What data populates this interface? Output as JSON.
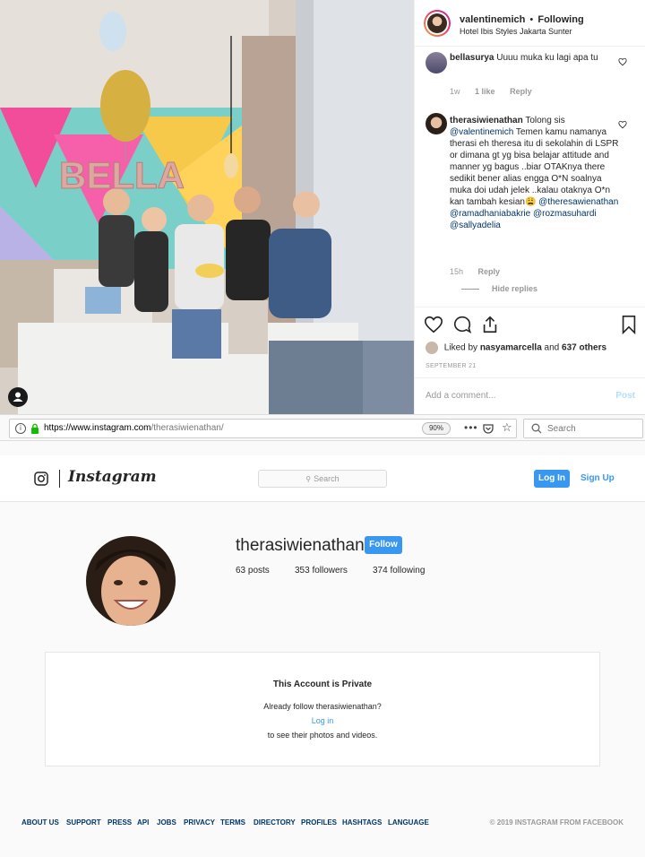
{
  "post": {
    "author": "valentinemich",
    "separator": "•",
    "follow_status": "Following",
    "location": "Hotel Ibis Styles Jakarta Sunter",
    "photo_text": "BELLA",
    "comments": [
      {
        "user": "bellasurya",
        "segments": [
          {
            "t": "Uuuu muka ku lagi apa tu",
            "m": false
          }
        ],
        "time": "1w",
        "likes": "1 like",
        "reply": "Reply"
      },
      {
        "user": "therasiwienathan",
        "segments": [
          {
            "t": "Tolong sis ",
            "m": false
          },
          {
            "t": "@valentinemich",
            "m": true
          },
          {
            "t": " Temen kamu namanya therasi eh theresa itu di sekolahin di LSPR or dimana gt yg bisa belajar attitude and manner yg bagus ..biar OTAKnya there sedikit bener alias engga O*N soalnya muka doi udah jelek ..kalau otaknya O*n kan tambah kesian😩 ",
            "m": false
          },
          {
            "t": "@theresawienathan",
            "m": true
          },
          {
            "t": " ",
            "m": false
          },
          {
            "t": "@ramadhaniabakrie",
            "m": true
          },
          {
            "t": " ",
            "m": false
          },
          {
            "t": "@rozmasuhardi",
            "m": true
          },
          {
            "t": " ",
            "m": false
          },
          {
            "t": "@sallyadelia",
            "m": true
          }
        ],
        "time": "15h",
        "reply": "Reply",
        "hide_replies": "Hide replies"
      }
    ],
    "liked_by_prefix": "Liked by",
    "liked_by_user": "nasyamarcella",
    "liked_by_and": "and",
    "liked_by_count": "637 others",
    "date": "SEPTEMBER 21",
    "add_comment_placeholder": "Add a comment...",
    "post_button": "Post"
  },
  "browser": {
    "url_domain": "https://www.instagram.com",
    "url_path": "/therasiwienathan/",
    "zoom": "90%",
    "more": "•••",
    "search_placeholder": "Search"
  },
  "profile_page": {
    "logo_text": "Instagram",
    "search_placeholder": "Search",
    "login_label": "Log In",
    "signup_label": "Sign Up",
    "username": "therasiwienathan",
    "follow_label": "Follow",
    "posts": "63 posts",
    "followers": "353 followers",
    "following": "374 following",
    "private_title": "This Account is Private",
    "already_follow": "Already follow therasiwienathan?",
    "login_link": "Log in",
    "see_text": "to see their photos and videos."
  },
  "footer": {
    "links": [
      "ABOUT US",
      "SUPPORT",
      "PRESS",
      "API",
      "JOBS",
      "PRIVACY",
      "TERMS",
      "DIRECTORY",
      "PROFILES",
      "HASHTAGS",
      "LANGUAGE"
    ],
    "copyright": "© 2019 INSTAGRAM FROM FACEBOOK"
  },
  "colors": {
    "accent_blue": "#3897f0",
    "link_dark": "#003569",
    "story_gradient_start": "#f9a13c",
    "story_gradient_end": "#b52ea0"
  }
}
